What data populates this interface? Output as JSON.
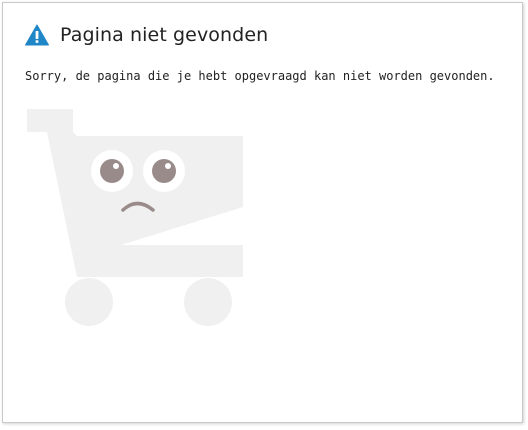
{
  "error_page": {
    "title": "Pagina niet gevonden",
    "message": "Sorry, de pagina die je hebt opgevraagd kan niet worden gevonden."
  },
  "icons": {
    "warning": "warning-triangle-icon",
    "illustration": "sad-shopping-cart-illustration"
  },
  "colors": {
    "warning_icon": "#1f86c8",
    "cart_fill": "#f0f0f0",
    "cart_eyes_pupil": "#9a8b8b",
    "text": "#222222"
  }
}
